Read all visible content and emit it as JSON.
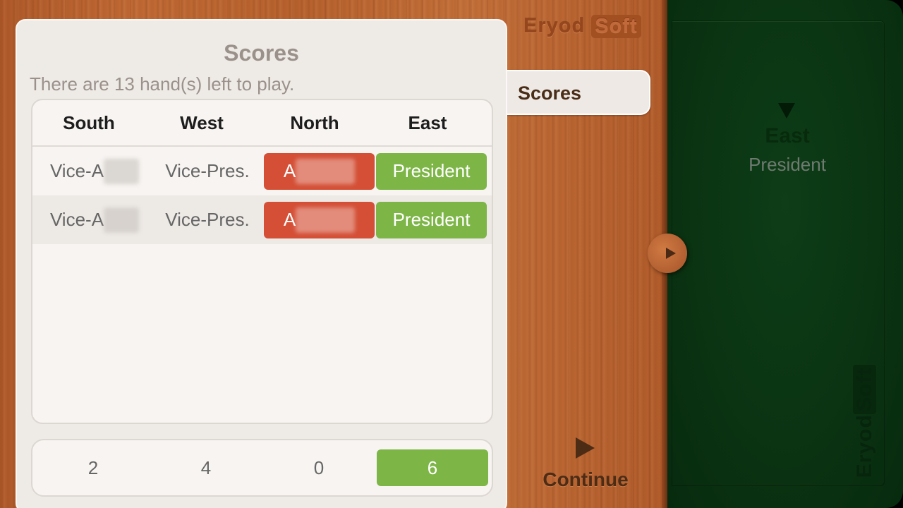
{
  "logo": {
    "left": "Eryod",
    "right": "Soft"
  },
  "side_tab": {
    "label": "Scores"
  },
  "panel": {
    "title": "Scores",
    "subtitle": "There are 13 hand(s) left to play."
  },
  "table": {
    "columns": [
      "South",
      "West",
      "North",
      "East"
    ],
    "rows": [
      {
        "south": "Vice-A",
        "west": "Vice-Pres.",
        "north": "A",
        "east": "President"
      },
      {
        "south": "Vice-A",
        "west": "Vice-Pres.",
        "north": "A",
        "east": "President"
      }
    ],
    "role_colors": {
      "asshole": "#d44f36",
      "president": "#7db547"
    }
  },
  "totals": [
    "2",
    "4",
    "0",
    "6"
  ],
  "felt": {
    "player": "East",
    "role": "President",
    "logo_left": "Eryod",
    "logo_right": "Soft"
  },
  "continue": {
    "label": "Continue"
  }
}
